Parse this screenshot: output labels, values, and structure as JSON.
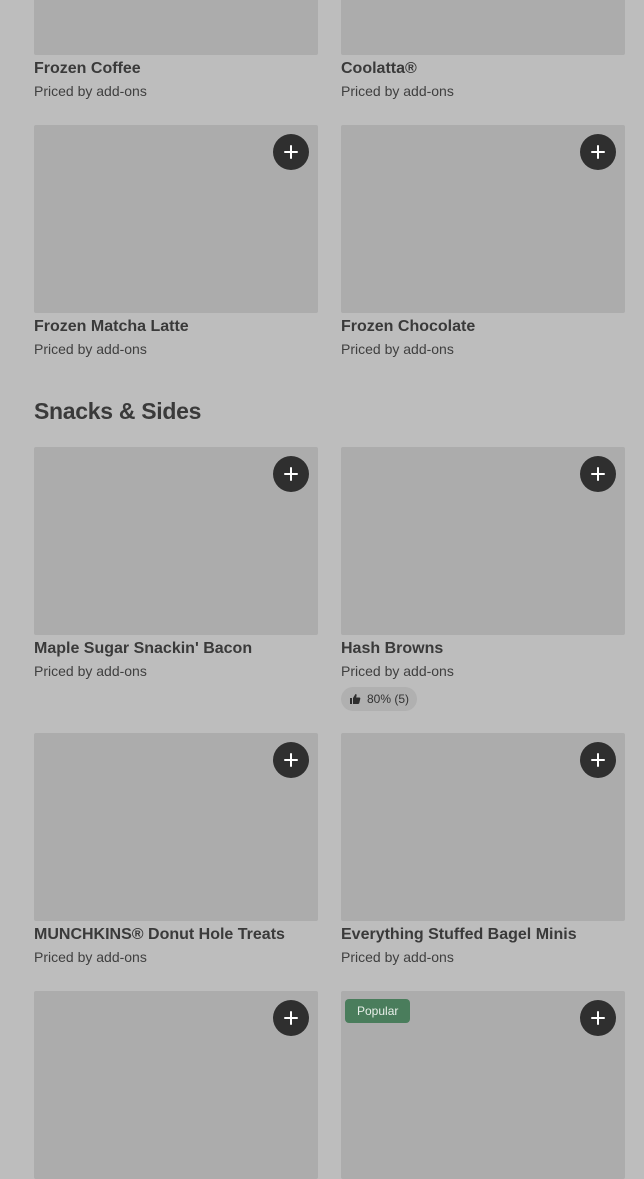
{
  "rows_top": {
    "items": [
      {
        "name": "Frozen Coffee",
        "price": "Priced by add-ons"
      },
      {
        "name": "Coolatta®",
        "price": "Priced by add-ons"
      }
    ]
  },
  "frozen_row2": {
    "items": [
      {
        "name": "Frozen Matcha Latte",
        "price": "Priced by add-ons",
        "add_icon": "plus-icon"
      },
      {
        "name": "Frozen Chocolate",
        "price": "Priced by add-ons",
        "add_icon": "plus-icon"
      }
    ]
  },
  "snacks": {
    "section_title": "Snacks & Sides",
    "items": [
      {
        "name": "Maple Sugar Snackin' Bacon",
        "price": "Priced by add-ons"
      },
      {
        "name": "Hash Browns",
        "price": "Priced by add-ons",
        "rating": "80% (5)",
        "rating_icon": "thumbs-up-icon"
      },
      {
        "name": "MUNCHKINS® Donut Hole Treats",
        "price": "Priced by add-ons"
      },
      {
        "name": "Everything Stuffed Bagel Minis",
        "price": "Priced by add-ons"
      }
    ],
    "bottom_row": {
      "badge": "Popular"
    }
  },
  "colors": {
    "overlay_bg": "#bdbdbd",
    "image_placeholder": "#acacac",
    "add_button": "#2f2f2f",
    "popular_badge": "#4a7d5c"
  }
}
